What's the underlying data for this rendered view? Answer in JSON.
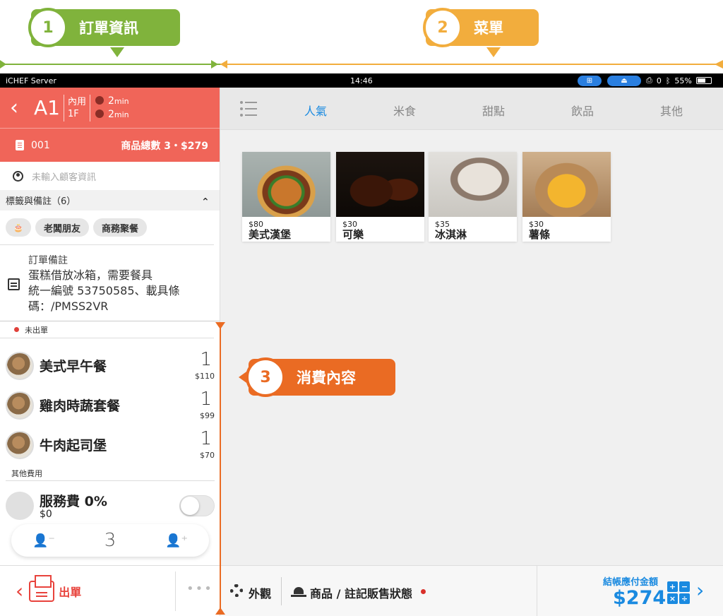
{
  "callouts": {
    "one": {
      "num": "1",
      "label": "訂單資訊"
    },
    "two": {
      "num": "2",
      "label": "菜單"
    },
    "three": {
      "num": "3",
      "label": "消費內容"
    }
  },
  "status_bar": {
    "carrier": "iCHEF Server",
    "time": "14:46",
    "printer_count": "0",
    "battery": "55%"
  },
  "order_header": {
    "table": "A1",
    "dine_type": "內用",
    "floor": "1F",
    "timer1": "2",
    "timer2": "2",
    "timer_unit": "min"
  },
  "order_bar": {
    "order_no": "001",
    "summary": "商品總數 3・$279"
  },
  "customer": {
    "placeholder": "未輸入顧客資訊"
  },
  "tags": {
    "header": "標籤與備註（6）",
    "items": [
      "老闆朋友",
      "商務聚餐"
    ]
  },
  "note": {
    "title": "訂單備註",
    "line1": "蛋糕借放冰箱，需要餐具",
    "line2": "統一編號 53750585、載具條",
    "line3": "碼：/PMSS2VR"
  },
  "unsent_label": "未出單",
  "items": [
    {
      "name": "美式早午餐",
      "qty": "1",
      "price": "$110"
    },
    {
      "name": "雞肉時蔬套餐",
      "qty": "1",
      "price": "$99"
    },
    {
      "name": "牛肉起司堡",
      "qty": "1",
      "price": "$70"
    }
  ],
  "other_fees": {
    "header": "其他費用",
    "service_name": "服務費 0%",
    "service_amount": "$0"
  },
  "guests": {
    "count": "3"
  },
  "left_footer": {
    "send_label": "出單",
    "more": "•••"
  },
  "tabs": [
    "人氣",
    "米食",
    "甜點",
    "飲品",
    "其他"
  ],
  "products": [
    {
      "price": "$80",
      "name": "美式漢堡"
    },
    {
      "price": "$30",
      "name": "可樂"
    },
    {
      "price": "$35",
      "name": "冰淇淋"
    },
    {
      "price": "$30",
      "name": "薯條"
    }
  ],
  "right_footer": {
    "appearance": "外觀",
    "goods_status": "商品 / 註記販售狀態",
    "due_label": "結帳應付金額",
    "due_amount": "$274"
  },
  "colors": {
    "header_red": "#f06559",
    "accent_blue": "#1a8ae0",
    "callout_green": "#80b33c",
    "callout_yellow": "#f2ad3d",
    "callout_orange": "#ea6b23"
  }
}
